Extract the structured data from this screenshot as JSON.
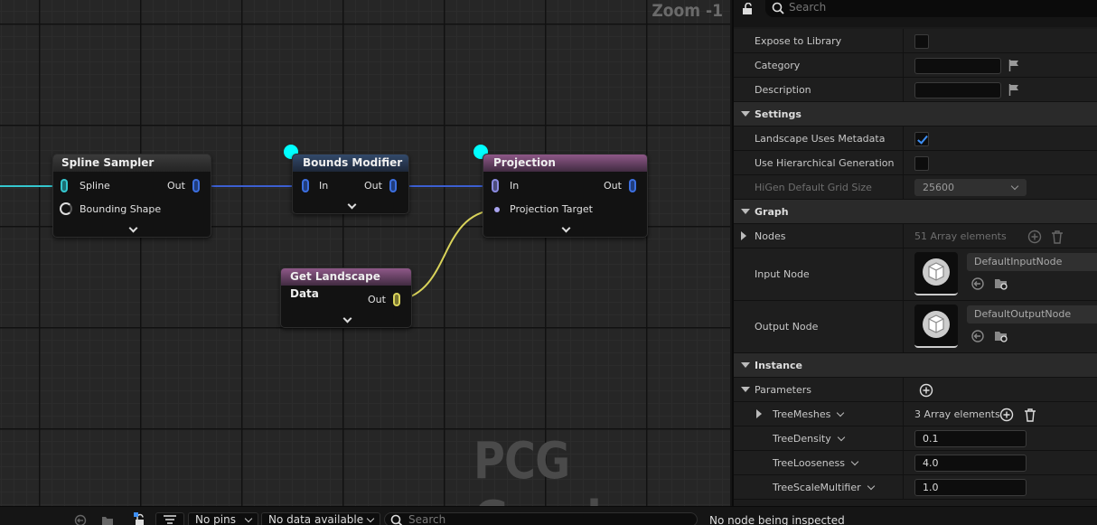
{
  "graph": {
    "zoom_label": "Zoom -1",
    "watermark": "PCG Graph",
    "nodes": {
      "spline_sampler": {
        "title": "Spline Sampler",
        "pins": {
          "spline": "Spline",
          "bounding_shape": "Bounding Shape",
          "out": "Out"
        }
      },
      "bounds_modifier": {
        "title": "Bounds Modifier",
        "pins": {
          "in": "In",
          "out": "Out"
        }
      },
      "projection": {
        "title": "Projection",
        "pins": {
          "in": "In",
          "projection_target": "Projection Target",
          "out": "Out"
        }
      },
      "get_landscape_data": {
        "title": "Get Landscape Data",
        "pins": {
          "out": "Out"
        }
      }
    },
    "colors": {
      "wire_spline": "#35c7cf",
      "wire_spatial": "#3c5fd2",
      "wire_landscape": "#d9d35a",
      "exec_pin": "#00ffff",
      "title_projection": "#8e5888",
      "title_bounds": "#334a6b"
    }
  },
  "details": {
    "search_placeholder": "Search",
    "rows": {
      "expose_to_library": "Expose to Library",
      "category": "Category",
      "description": "Description"
    },
    "settings": {
      "header": "Settings",
      "landscape_uses_metadata": "Landscape Uses Metadata",
      "use_hierarchical_generation": "Use Hierarchical Generation",
      "higen_grid_size_label": "HiGen Default Grid Size",
      "higen_grid_size_value": "25600"
    },
    "graph_section": {
      "header": "Graph",
      "nodes_label": "Nodes",
      "nodes_count": "51 Array elements",
      "input_node_label": "Input Node",
      "input_node_value": "DefaultInputNode",
      "output_node_label": "Output Node",
      "output_node_value": "DefaultOutputNode"
    },
    "instance": {
      "header": "Instance",
      "parameters_label": "Parameters",
      "tree_meshes_label": "TreeMeshes",
      "tree_meshes_count": "3 Array elements",
      "tree_density_label": "TreeDensity",
      "tree_density_value": "0.1",
      "tree_looseness_label": "TreeLooseness",
      "tree_looseness_value": "4.0",
      "tree_scale_label": "TreeScaleMultifier",
      "tree_scale_value": "1.0"
    }
  },
  "bottombar": {
    "pins_filter": "No pins",
    "data_filter": "No data available",
    "search_placeholder": "Search",
    "status": "No node being inspected"
  }
}
